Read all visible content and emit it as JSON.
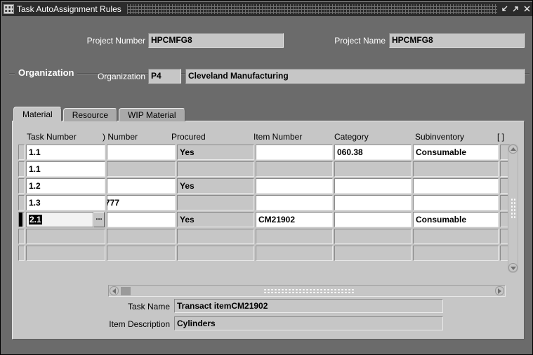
{
  "window": {
    "title": "Task AutoAssignment Rules",
    "app_icon": "oracle-forms-icon",
    "controls": {
      "minimize": "minimize-icon",
      "maximize": "maximize-icon",
      "close": "close-icon"
    }
  },
  "header": {
    "project_number_label": "Project Number",
    "project_number_value": "HPCMFG8",
    "project_name_label": "Project Name",
    "project_name_value": "HPCMFG8"
  },
  "organization": {
    "group_label": "Organization",
    "org_label": "Organization",
    "org_code": "P4",
    "org_name": "Cleveland Manufacturing"
  },
  "tabs": [
    {
      "label": "Material",
      "selected": true
    },
    {
      "label": "Resource",
      "selected": false
    },
    {
      "label": "WIP Material",
      "selected": false
    }
  ],
  "grid": {
    "columns": [
      {
        "label": "Task Number"
      },
      {
        "label": ") Number"
      },
      {
        "label": "Procured"
      },
      {
        "label": "Item Number"
      },
      {
        "label": "Category"
      },
      {
        "label": "Subinventory"
      },
      {
        "label": "[ ]"
      }
    ],
    "rows": [
      {
        "current": false,
        "task_number": "1.1",
        "task_enabled": true,
        "order_number": "",
        "order_enabled": true,
        "procured": "Yes",
        "procured_enabled": true,
        "item_number": "",
        "item_enabled": true,
        "category": "060.38",
        "category_enabled": true,
        "subinventory": "Consumable",
        "sub_enabled": true,
        "flex": "",
        "flex_enabled": false
      },
      {
        "current": false,
        "task_number": "1.1",
        "task_enabled": true,
        "order_number": "",
        "order_enabled": false,
        "procured": "",
        "procured_enabled": false,
        "item_number": "",
        "item_enabled": false,
        "category": "",
        "category_enabled": false,
        "subinventory": "",
        "sub_enabled": false,
        "flex": "",
        "flex_enabled": false
      },
      {
        "current": false,
        "task_number": "1.2",
        "task_enabled": true,
        "order_number": "",
        "order_enabled": true,
        "procured": "Yes",
        "procured_enabled": true,
        "item_number": "",
        "item_enabled": true,
        "category": "",
        "category_enabled": true,
        "subinventory": "",
        "sub_enabled": true,
        "flex": "",
        "flex_enabled": false
      },
      {
        "current": false,
        "task_number": "1.3",
        "task_enabled": true,
        "order_number": "777",
        "order_enabled": true,
        "procured": "",
        "procured_enabled": false,
        "item_number": "",
        "item_enabled": true,
        "category": "",
        "category_enabled": true,
        "subinventory": "",
        "sub_enabled": true,
        "flex": "",
        "flex_enabled": false
      },
      {
        "current": true,
        "task_number": "2.1",
        "task_enabled": true,
        "task_focused": true,
        "task_lov": "...",
        "order_number": "",
        "order_enabled": true,
        "procured": "Yes",
        "procured_enabled": true,
        "item_number": "CM21902",
        "item_enabled": true,
        "category": "",
        "category_enabled": true,
        "subinventory": "Consumable",
        "sub_enabled": true,
        "flex": "",
        "flex_enabled": false
      },
      {
        "current": false,
        "task_number": "",
        "task_enabled": false,
        "order_number": "",
        "order_enabled": false,
        "procured": "",
        "procured_enabled": false,
        "item_number": "",
        "item_enabled": false,
        "category": "",
        "category_enabled": false,
        "subinventory": "",
        "sub_enabled": false,
        "flex": "",
        "flex_enabled": false
      },
      {
        "current": false,
        "task_number": "",
        "task_enabled": false,
        "order_number": "",
        "order_enabled": false,
        "procured": "",
        "procured_enabled": false,
        "item_number": "",
        "item_enabled": false,
        "category": "",
        "category_enabled": false,
        "subinventory": "",
        "sub_enabled": false,
        "flex": "",
        "flex_enabled": false
      }
    ]
  },
  "detail": {
    "task_name_label": "Task Name",
    "task_name_value": "Transact itemCM21902",
    "item_description_label": "Item Description",
    "item_description_value": "Cylinders"
  },
  "colors": {
    "form_background": "#6b6b6b",
    "titlebar": "#2b2b2b",
    "canvas": "#c6c6c6",
    "field": "#c6c6c6",
    "field_enabled": "#ffffff",
    "tab_selected": "#c6c6c6",
    "tab_unselected": "#a9a9a9"
  }
}
